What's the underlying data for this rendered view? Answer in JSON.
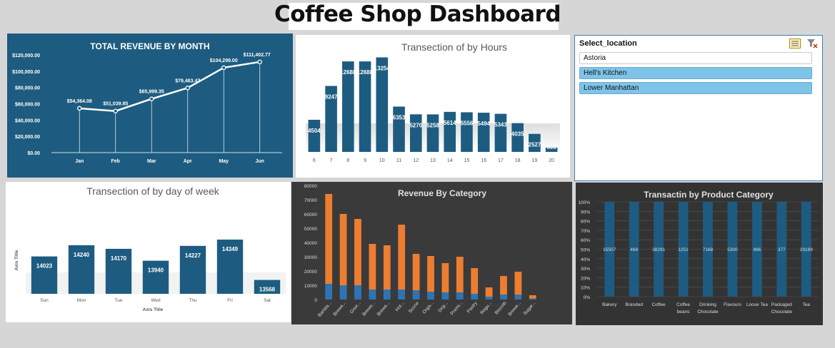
{
  "dashboard": {
    "title": "Coffee Shop  Dashboard"
  },
  "slicer": {
    "title": "Select_location",
    "items": [
      {
        "label": "Astoria",
        "selected": false
      },
      {
        "label": "Hell's Kitchen",
        "selected": true
      },
      {
        "label": "Lower Manhattan",
        "selected": true
      }
    ],
    "icons": [
      "multi-select-icon",
      "clear-filter-icon"
    ]
  },
  "chart_data": [
    {
      "id": "revenue-month",
      "type": "line",
      "title": "TOTAL REVENUE BY MONTH",
      "categories": [
        "Jan",
        "Feb",
        "Mar",
        "Apr",
        "May",
        "Jun"
      ],
      "values": [
        54364.08,
        51039.85,
        65999.35,
        79463.47,
        104299.0,
        111402.77
      ],
      "data_labels": [
        "$54,364.08",
        "$51,039.85",
        "$65,999.35",
        "$79,463.47",
        "$104,299.00",
        "$111,402.77"
      ],
      "y_ticks": [
        "$0.00",
        "$20,000.00",
        "$40,000.00",
        "$60,000.00",
        "$80,000.00",
        "$100,000.00",
        "$120,000.00"
      ],
      "ylim": [
        0,
        120000
      ],
      "background": "#1d5c80"
    },
    {
      "id": "hours",
      "type": "bar",
      "title": "Transection of by Hours",
      "categories": [
        "6",
        "7",
        "8",
        "9",
        "10",
        "11",
        "12",
        "13",
        "14",
        "15",
        "16",
        "17",
        "18",
        "19",
        "20"
      ],
      "values": [
        4504,
        9247,
        12688,
        12688,
        13254,
        6353,
        5270,
        5258,
        5614,
        5556,
        5494,
        5343,
        4035,
        2527,
        603
      ],
      "data_labels": [
        "4504",
        "9247",
        "12688",
        "12688",
        "13254",
        "6353",
        "5270",
        "5258",
        "5614",
        "5556",
        "5494",
        "5343",
        "4035",
        "2527",
        "603"
      ],
      "ylim": [
        0,
        14000
      ],
      "bar_color": "#1d5c80"
    },
    {
      "id": "weekday",
      "type": "bar",
      "title": "Transection  of by day of week",
      "categories": [
        "Sun",
        "Mon",
        "Tue",
        "Wed",
        "Thu",
        "Fri",
        "Sat"
      ],
      "values": [
        14023,
        14240,
        14170,
        13940,
        14227,
        14349,
        13568
      ],
      "ylim": [
        13300,
        14500
      ],
      "xlabel": "Axis Title",
      "ylabel": "Axis Title",
      "bar_color": "#1d5c80"
    },
    {
      "id": "category-revenue",
      "type": "bar",
      "title": "Revenue By Category",
      "categories": [
        "Barista...",
        "Brewe...",
        "Gour...",
        "Brewe...",
        "Brewe...",
        "Hot...",
        "Scone",
        "Orga...",
        "Drip...",
        "Premi...",
        "Pastry",
        "Regu...",
        "Biscotti",
        "Brewe...",
        "Sugar..."
      ],
      "series": [
        {
          "values": [
            11000,
            10000,
            10000,
            7000,
            7000,
            7000,
            6500,
            5500,
            5000,
            5000,
            4000,
            2000,
            3500,
            3500,
            700
          ]
        },
        {
          "values": [
            74000,
            60000,
            56500,
            39000,
            38000,
            52500,
            32000,
            30500,
            25500,
            30000,
            22000,
            8500,
            16500,
            19500,
            3000
          ]
        }
      ],
      "y_ticks": [
        "0",
        "10000",
        "20000",
        "30000",
        "40000",
        "50000",
        "60000",
        "70000",
        "80000"
      ],
      "ylim": [
        0,
        80000
      ],
      "colors": [
        "#2e74b5",
        "#ed7d31"
      ]
    },
    {
      "id": "product-category",
      "type": "bar",
      "title": "Transactin by Product Category",
      "categories": [
        [
          "Bakery"
        ],
        [
          "Branded"
        ],
        [
          "Coffee"
        ],
        [
          "Coffee",
          "beans"
        ],
        [
          "Drinking",
          "Chocolate"
        ],
        [
          "Flavours"
        ],
        [
          "Loose Tea"
        ],
        [
          "Packaged",
          "Chocolate"
        ],
        [
          "Tea"
        ]
      ],
      "data_labels": [
        "15507",
        "468",
        "38291",
        "1251",
        "7168",
        "5300",
        "866",
        "377",
        "29189"
      ],
      "values_percent": [
        100,
        100,
        100,
        100,
        100,
        100,
        100,
        100,
        100
      ],
      "y_ticks": [
        "0%",
        "10%",
        "20%",
        "30%",
        "40%",
        "50%",
        "60%",
        "70%",
        "80%",
        "90%",
        "100%"
      ],
      "ylim": [
        0,
        100
      ],
      "bar_color": "#1d5c80"
    }
  ]
}
